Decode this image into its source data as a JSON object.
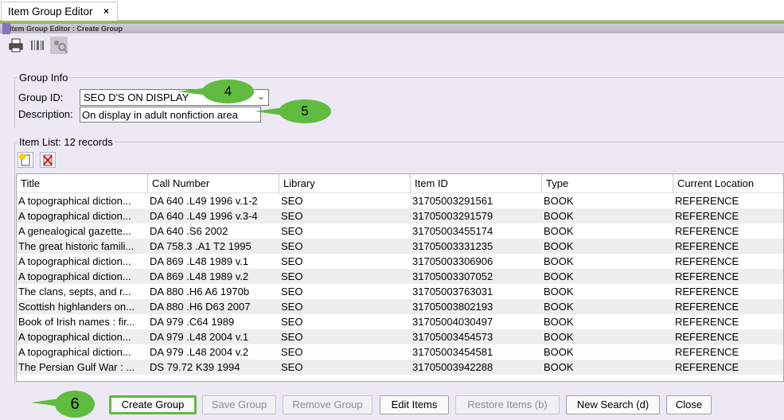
{
  "tab": {
    "label": "Item Group Editor",
    "close": "×"
  },
  "titlebar": {
    "text": "Item Group Editor : Create Group"
  },
  "toolbar": {
    "icons": [
      "print-icon",
      "barcode-icon",
      "search-people-icon"
    ]
  },
  "group_info": {
    "legend": "Group Info",
    "group_id_label": "Group ID:",
    "group_id_value": "SEO D'S ON DISPLAY",
    "description_label": "Description:",
    "description_value": "On display in adult nonfiction area"
  },
  "callouts": {
    "c4": "4",
    "c5": "5",
    "c6": "6"
  },
  "item_list": {
    "legend": "Item List: 12 records",
    "columns": [
      "Title",
      "Call Number",
      "Library",
      "Item ID",
      "Type",
      "Current Location"
    ],
    "rows": [
      [
        "A topographical diction...",
        "DA 640 .L49 1996 v.1-2",
        "SEO",
        "31705003291561",
        "BOOK",
        "REFERENCE"
      ],
      [
        "A topographical diction...",
        "DA 640 .L49 1996 v.3-4",
        "SEO",
        "31705003291579",
        "BOOK",
        "REFERENCE"
      ],
      [
        "A genealogical gazette...",
        "DA 640 .S6 2002",
        "SEO",
        "31705003455174",
        "BOOK",
        "REFERENCE"
      ],
      [
        "The great historic famili...",
        "DA 758.3 .A1 T2 1995",
        "SEO",
        "31705003331235",
        "BOOK",
        "REFERENCE"
      ],
      [
        "A topographical diction...",
        "DA 869 .L48 1989 v.1",
        "SEO",
        "31705003306906",
        "BOOK",
        "REFERENCE"
      ],
      [
        "A topographical diction...",
        "DA 869 .L48 1989 v.2",
        "SEO",
        "31705003307052",
        "BOOK",
        "REFERENCE"
      ],
      [
        "The clans, septs, and r...",
        "DA 880 .H6 A6 1970b",
        "SEO",
        "31705003763031",
        "BOOK",
        "REFERENCE"
      ],
      [
        "Scottish highlanders on...",
        "DA 880 .H6 D63 2007",
        "SEO",
        "31705003802193",
        "BOOK",
        "REFERENCE"
      ],
      [
        "Book of Irish names : fir...",
        "DA 979 .C64 1989",
        "SEO",
        "31705004030497",
        "BOOK",
        "REFERENCE"
      ],
      [
        "A topographical diction...",
        "DA 979 .L48 2004 v.1",
        "SEO",
        "31705003454573",
        "BOOK",
        "REFERENCE"
      ],
      [
        "A topographical diction...",
        "DA 979 .L48 2004 v.2",
        "SEO",
        "31705003454581",
        "BOOK",
        "REFERENCE"
      ],
      [
        "The Persian Gulf War : ...",
        "DS 79.72 K39 1994",
        "SEO",
        "31705003942288",
        "BOOK",
        "REFERENCE"
      ]
    ]
  },
  "buttons": {
    "create": "Create Group",
    "save": "Save Group",
    "remove": "Remove Group",
    "edit": "Edit Items",
    "restore": "Restore Items (b)",
    "new_search": "New Search (d)",
    "close": "Close"
  },
  "colors": {
    "accent_green": "#5fbc3f",
    "pane_bg": "#ece9f5",
    "tab_green": "#9bbb59"
  }
}
